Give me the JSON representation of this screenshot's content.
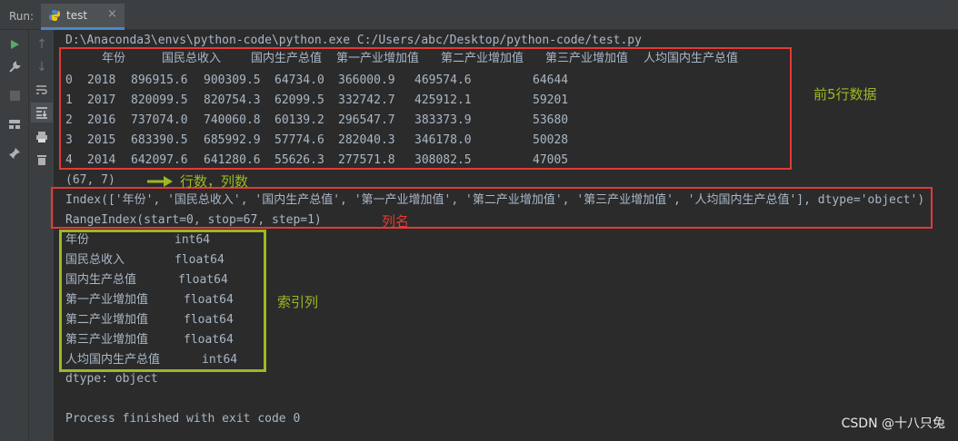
{
  "run_bar": {
    "label": "Run:",
    "tab_title": "test"
  },
  "console": {
    "command": "D:\\Anaconda3\\envs\\python-code\\python.exe C:/Users/abc/Desktop/python-code/test.py",
    "head_columns": [
      "年份",
      "国民总收入",
      "国内生产总值",
      "第一产业增加值",
      "第二产业增加值",
      "第三产业增加值",
      "人均国内生产总值"
    ],
    "head_rows": [
      [
        "0",
        "2018",
        "896915.6",
        "900309.5",
        "64734.0",
        "366000.9",
        "469574.6",
        "64644"
      ],
      [
        "1",
        "2017",
        "820099.5",
        "820754.3",
        "62099.5",
        "332742.7",
        "425912.1",
        "59201"
      ],
      [
        "2",
        "2016",
        "737074.0",
        "740060.8",
        "60139.2",
        "296547.7",
        "383373.9",
        "53680"
      ],
      [
        "3",
        "2015",
        "683390.5",
        "685992.9",
        "57774.6",
        "282040.3",
        "346178.0",
        "50028"
      ],
      [
        "4",
        "2014",
        "642097.6",
        "641280.6",
        "55626.3",
        "277571.8",
        "308082.5",
        "47005"
      ]
    ],
    "shape": "(67, 7)",
    "columns_index": "Index(['年份', '国民总收入', '国内生产总值', '第一产业增加值', '第二产业增加值', '第三产业增加值', '人均国内生产总值'], dtype='object')",
    "range_index": "RangeIndex(start=0, stop=67, step=1)",
    "dtypes": [
      {
        "name": "年份",
        "type": "int64"
      },
      {
        "name": "国民总收入",
        "type": "float64"
      },
      {
        "name": "国内生产总值",
        "type": "float64"
      },
      {
        "name": "第一产业增加值",
        "type": "float64"
      },
      {
        "name": "第二产业增加值",
        "type": "float64"
      },
      {
        "name": "第三产业增加值",
        "type": "float64"
      },
      {
        "name": "人均国内生产总值",
        "type": "int64"
      }
    ],
    "dtype_line": "dtype: object",
    "exit_line": "Process finished with exit code 0"
  },
  "annotations": {
    "head": "前5行数据",
    "shape": "行数，列数",
    "columns": "列名",
    "dtypes": "索引列"
  },
  "watermark": "CSDN @十八只兔",
  "colors": {
    "red_box": "#e53935",
    "green_box": "#9ab923",
    "annot_red": "#e53935",
    "annot_green": "#9ab923"
  }
}
